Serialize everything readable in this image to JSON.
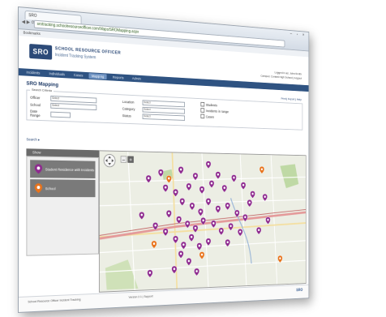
{
  "browser": {
    "tab_title": "SRO",
    "url": "srotracking.schoolresourceofficer.com/Maps/SROMapping.aspx",
    "bookmark": "Bookmarks",
    "window_controls": "– ▫ ×",
    "nav_controls": "◀ ▶ ⟳"
  },
  "header": {
    "logo_text": "SRO",
    "brand_title": "SCHOOL RESOURCE OFFICER",
    "brand_subtitle": "Incident Tracking System",
    "user_line1": "Logged in as: John Smith",
    "user_line2": "Campus: Central High School  |  Logout"
  },
  "nav": {
    "items": [
      "Incidents",
      "Individuals",
      "Cases",
      "Mapping",
      "Reports",
      "Admin"
    ]
  },
  "page": {
    "title": "SRO Mapping",
    "tools": "Print  |  Export  |  Help"
  },
  "filters": {
    "legend": "Search Criteria",
    "officer_label": "Officer",
    "officer_value": "Select",
    "school_label": "School",
    "school_value": "Select",
    "date_label": "Date Range",
    "date_value": "",
    "location_label": "Location",
    "location_value": "Select",
    "category_label": "Category",
    "category_value": "Select",
    "status_label": "Status",
    "status_value": "Select",
    "check1": "Students",
    "check2": "Incidents in range",
    "check3": "Cases",
    "search_btn": "Search ▸"
  },
  "legend": {
    "header": "Show",
    "items": [
      {
        "label": "Student Residence with Incidents",
        "color": "#8e2a8f"
      },
      {
        "label": "School",
        "color": "#e8731c"
      }
    ]
  },
  "map": {
    "zoom_in": "+",
    "zoom_out": "–",
    "road_label": "",
    "marker_color_student": "#8e2a8f",
    "marker_color_school": "#e8731c"
  },
  "footer": {
    "left": "School Resource Officer Incident Tracking",
    "middle": "Version 2.1  |  Support",
    "logo": "SRO"
  }
}
